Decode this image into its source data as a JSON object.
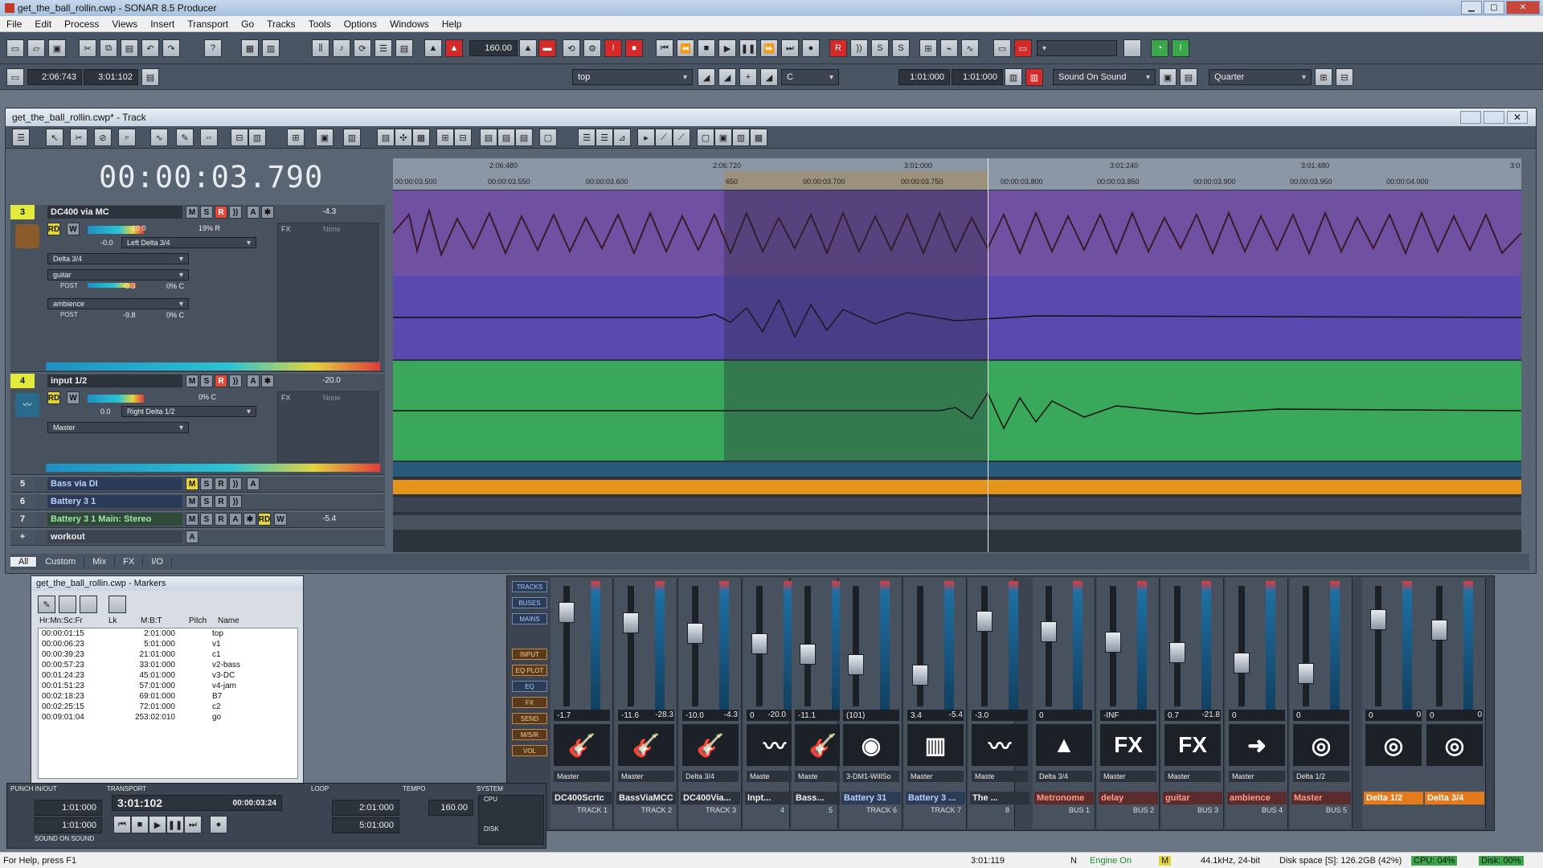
{
  "window": {
    "title": "get_the_ball_rollin.cwp - SONAR 8.5 Producer"
  },
  "menu": [
    "File",
    "Edit",
    "Process",
    "Views",
    "Insert",
    "Transport",
    "Go",
    "Tracks",
    "Tools",
    "Options",
    "Windows",
    "Help"
  ],
  "toolbar": {
    "tempo": "160.00",
    "time_start": "2:06:743",
    "time_end": "3:01:102",
    "marker_select": "top",
    "key_select": "C",
    "punch_start": "1:01:000",
    "punch_end": "1:01:000",
    "sound_on_sound": "Sound On Sound",
    "snap": "Quarter"
  },
  "track_view": {
    "title": "get_the_ball_rollin.cwp* - Track",
    "clock": "00:00:03.790",
    "ruler_top": [
      "2:06:480",
      "2:06:720",
      "3:01:000",
      "3:01:240",
      "3:01:480",
      "3:0"
    ],
    "ruler_bottom": [
      "00:00:03.500",
      "00:00:03.550",
      "00:00:03.600",
      "650",
      "00:00:03.700",
      "00:00:03.750",
      "00:00:03.800",
      "00:00:03.850",
      "00:00:03.900",
      "00:00:03.950",
      "00:00:04.000"
    ],
    "tracks": [
      {
        "num": "3",
        "name": "DC400 via MC",
        "vol": "-4.3",
        "vol_db": "-10.0",
        "pan": "19% R",
        "trim": "-0.0",
        "output": "Left Delta 3/4",
        "input": "Delta 3/4",
        "send1": "guitar",
        "send1_level": "-0.3",
        "send1_pan": "0% C",
        "send2": "ambience",
        "send2_level": "-9.8",
        "send2_pan": "0% C",
        "fx": "FX",
        "fx_none": "None",
        "post": "POST"
      },
      {
        "num": "4",
        "name": "input 1/2",
        "vol": "-20.0",
        "pan": "0% C",
        "trim": "0.0",
        "output": "Right Delta 1/2",
        "input": "Master",
        "fx": "FX",
        "fx_none": "None"
      },
      {
        "num": "5",
        "name": "Bass via DI"
      },
      {
        "num": "6",
        "name": "Battery 3 1"
      },
      {
        "num": "7",
        "name": "Battery 3 1 Main: Stereo",
        "vol": "-5.4"
      },
      {
        "num": "",
        "name": "workout"
      }
    ],
    "meter_scale": [
      "-54",
      "-48",
      "-42",
      "-36",
      "-30",
      "-24",
      "-18",
      "-12",
      "-6"
    ],
    "db_scale": [
      "-18",
      "-21",
      "-24",
      "dB",
      "-21",
      "-18"
    ],
    "tabs": [
      "All",
      "Custom",
      "Mix",
      "FX",
      "I/O"
    ]
  },
  "markers": {
    "title": "get_the_ball_rollin.cwp - Markers",
    "headers": [
      "Hr:Mn:Sc:Fr",
      "Lk",
      "M:B:T",
      "Pitch",
      "Name"
    ],
    "rows": [
      {
        "time": "00:00:01:15",
        "mbt": "2:01:000",
        "name": "top"
      },
      {
        "time": "00:00:06:23",
        "mbt": "5:01:000",
        "name": "v1"
      },
      {
        "time": "00:00:39:23",
        "mbt": "21:01:000",
        "name": "c1"
      },
      {
        "time": "00:00:57:23",
        "mbt": "33:01:000",
        "name": "v2-bass"
      },
      {
        "time": "00:01:24:23",
        "mbt": "45:01:000",
        "name": "v3-DC"
      },
      {
        "time": "00:01:51:23",
        "mbt": "57:01:000",
        "name": "v4-jam"
      },
      {
        "time": "00:02:18:23",
        "mbt": "69:01:000",
        "name": "B7"
      },
      {
        "time": "00:02:25:15",
        "mbt": "72:01:000",
        "name": "c2"
      },
      {
        "time": "00:09:01:04",
        "mbt": "253:02:010",
        "name": "go"
      }
    ]
  },
  "console": {
    "nav": [
      "TRACKS",
      "BUSES",
      "MAINS",
      "INPUT",
      "EQ PLOT",
      "EQ",
      "FX",
      "SEND",
      "M/S/R",
      "VOL"
    ],
    "strips": [
      {
        "name": "DC400Scrtc",
        "val": "-1.7",
        "out": "Master",
        "label": "TRACK 1",
        "icon": "guitar-icon",
        "glyph": "🎸",
        "color": ""
      },
      {
        "name": "BassViaMCC",
        "val": "-11.6",
        "val2": "-28.3",
        "out": "Master",
        "label": "TRACK 2",
        "icon": "bass-icon",
        "glyph": "🎸",
        "color": ""
      },
      {
        "name": "DC400Via...",
        "val": "-10.0",
        "val2": "-4.3",
        "out": "Delta 3/4",
        "label": "TRACK 3",
        "icon": "guitar-icon",
        "glyph": "🎸",
        "color": ""
      },
      {
        "name": "Inpt...",
        "val": "0",
        "val2": "-20.0",
        "out": "Maste",
        "label": "4",
        "icon": "waveform-icon",
        "glyph": "〰",
        "color": ""
      },
      {
        "name": "Bass...",
        "val": "-11.1",
        "out": "Maste",
        "label": "5",
        "icon": "bass-icon",
        "glyph": "🎸",
        "color": ""
      },
      {
        "name": "Battery 31",
        "val": "(101)",
        "out": "3-DM1-WillSo",
        "label": "TRACK 6",
        "icon": "midi-icon",
        "glyph": "◉",
        "color": "blue"
      },
      {
        "name": "Battery 3 ...",
        "val": "3.4",
        "val2": "-5.4",
        "out": "Master",
        "label": "TRACK 7",
        "icon": "keyboard-icon",
        "glyph": "▥",
        "color": "blue"
      },
      {
        "name": "The ...",
        "val": "-3.0",
        "out": "Maste",
        "label": "8",
        "icon": "waveform-icon",
        "glyph": "〰",
        "color": ""
      },
      {
        "name": "Metronome",
        "val": "0",
        "out": "Delta 3/4",
        "label": "BUS 1",
        "icon": "metronome-icon",
        "glyph": "▲",
        "color": "red"
      },
      {
        "name": "delay",
        "val": "-INF",
        "out": "Master",
        "label": "BUS 2",
        "icon": "fx-icon",
        "glyph": "FX",
        "color": "red"
      },
      {
        "name": "guitar",
        "val": "0.7",
        "val2": "-21.8",
        "out": "Master",
        "label": "BUS 3",
        "icon": "fx-icon",
        "glyph": "FX",
        "color": "red"
      },
      {
        "name": "ambience",
        "val": "0",
        "out": "Master",
        "label": "BUS 4",
        "icon": "arrow-icon",
        "glyph": "➜",
        "color": "red"
      },
      {
        "name": "Master",
        "val": "0",
        "out": "Delta 1/2",
        "label": "BUS 5",
        "icon": "master-icon",
        "glyph": "◎",
        "color": "red"
      },
      {
        "name": "Delta 1/2",
        "val": "0",
        "val2": "0",
        "out": "",
        "label": "",
        "icon": "speaker-icon",
        "glyph": "◎",
        "color": "orange"
      },
      {
        "name": "Delta 3/4",
        "val": "0",
        "val2": "0",
        "out": "",
        "label": "",
        "icon": "speaker-icon",
        "glyph": "◎",
        "color": "orange"
      }
    ]
  },
  "control_bar": {
    "punch_label": "PUNCH IN/OUT",
    "punch_in": "1:01:000",
    "punch_out": "1:01:000",
    "sos": "SOUND ON SOUND",
    "transport_label": "TRANSPORT",
    "now_mbt": "3:01:102",
    "now_time": "00:00:03:24",
    "loop_label": "LOOP",
    "loop_start": "2:01:000",
    "loop_end": "5:01:000",
    "tempo_label": "TEMPO",
    "tempo": "160.00",
    "system_label": "SYSTEM",
    "cpu": "CPU",
    "disk": "DISK"
  },
  "status": {
    "help": "For Help, press F1",
    "time": "3:01:119",
    "n": "N",
    "engine": "Engine On",
    "m": "M",
    "format": "44.1kHz, 24-bit",
    "disk": "Disk space [S]: 126.2GB (42%)",
    "cpu": "CPU: 04%",
    "diskpct": "Disk: 00%"
  }
}
